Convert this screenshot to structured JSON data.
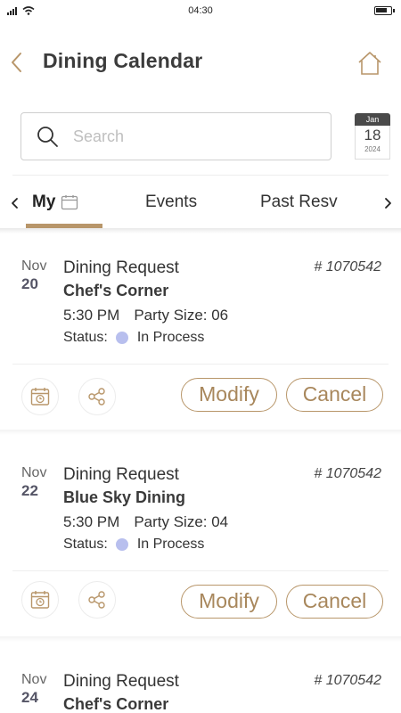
{
  "status_bar": {
    "time": "04:30"
  },
  "header": {
    "title": "Dining Calendar"
  },
  "search": {
    "placeholder": "Search"
  },
  "calendar_widget": {
    "month": "Jan",
    "day": "18",
    "year": "2024"
  },
  "tabs": [
    {
      "label": "My",
      "active": true
    },
    {
      "label": "Events",
      "active": false
    },
    {
      "label": "Past Resv",
      "active": false
    }
  ],
  "colors": {
    "accent": "#b8966a",
    "status_in_process": "#b8bfee",
    "title_text": "#3c3c3c"
  },
  "reservations": [
    {
      "month": "Nov",
      "day": "20",
      "type": "Dining Request",
      "number": "# 1070542",
      "venue": "Chef's Corner",
      "time": "5:30 PM",
      "party_size": "Party Size: 06",
      "status_label": "Status:",
      "status": "In Process",
      "modify_label": "Modify",
      "cancel_label": "Cancel"
    },
    {
      "month": "Nov",
      "day": "22",
      "type": "Dining Request",
      "number": "# 1070542",
      "venue": "Blue Sky Dining",
      "time": "5:30 PM",
      "party_size": "Party Size: 04",
      "status_label": "Status:",
      "status": "In Process",
      "modify_label": "Modify",
      "cancel_label": "Cancel"
    },
    {
      "month": "Nov",
      "day": "24",
      "type": "Dining Request",
      "number": "# 1070542",
      "venue": "Chef's Corner"
    }
  ]
}
